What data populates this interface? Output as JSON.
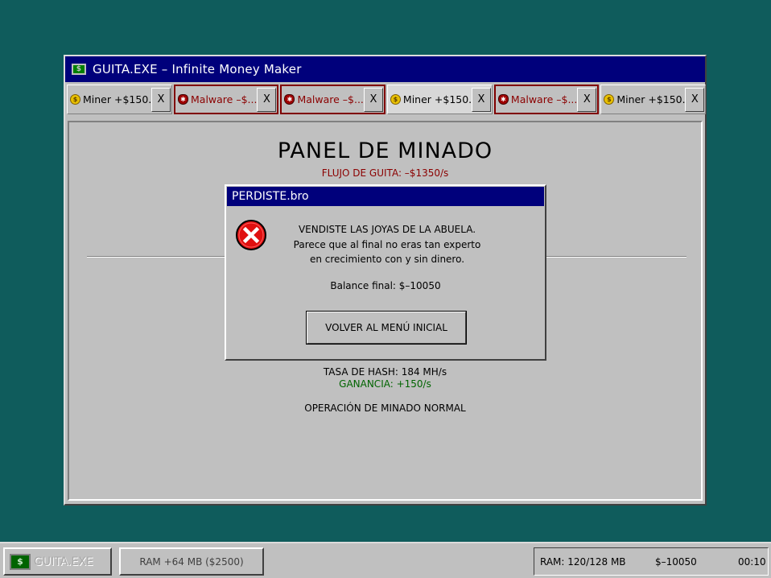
{
  "window": {
    "title": "GUITA.EXE – Infinite Money Maker"
  },
  "tabs": [
    {
      "label": "Miner +$150...",
      "type": "miner",
      "icon": "coin-icon",
      "close": "X",
      "active": false
    },
    {
      "label": "Malware –$...",
      "type": "malware",
      "icon": "bug-icon",
      "close": "X",
      "active": false
    },
    {
      "label": "Malware –$...",
      "type": "malware",
      "icon": "bug-icon",
      "close": "X",
      "active": false
    },
    {
      "label": "Miner +$150...",
      "type": "miner",
      "icon": "coin-icon",
      "close": "X",
      "active": true
    },
    {
      "label": "Malware –$...",
      "type": "malware",
      "icon": "bug-icon",
      "close": "X",
      "active": false
    },
    {
      "label": "Miner +$150...",
      "type": "miner",
      "icon": "coin-icon",
      "close": "X",
      "active": false
    }
  ],
  "panel": {
    "title": "PANEL DE MINADO",
    "flow": "FLUJO DE GUITA: –$1350/s",
    "hash_rate": "TASA DE HASH: 184 MH/s",
    "gain": "GANANCIA: +150/s",
    "status": "OPERACIÓN DE MINADO NORMAL"
  },
  "dialog": {
    "title": "PERDISTE.bro",
    "icon": "error-icon",
    "line1": "VENDISTE LAS JOYAS DE LA ABUELA.",
    "line2": "Parece que al final no eras tan experto",
    "line3": "en crecimiento con y sin dinero.",
    "balance": "Balance final: $–10050",
    "button": "VOLVER AL MENÚ INICIAL"
  },
  "taskbar": {
    "start_label": "GUITA.EXE",
    "ram_button": "RAM +64 MB ($2500)",
    "ram_status": "RAM: 120/128 MB",
    "balance": "$–10050",
    "time": "00:10"
  },
  "colors": {
    "desktop": "#0f5c5c",
    "titlebar": "#00007b",
    "malware_text": "#8b0000",
    "gain_text": "#006400"
  }
}
